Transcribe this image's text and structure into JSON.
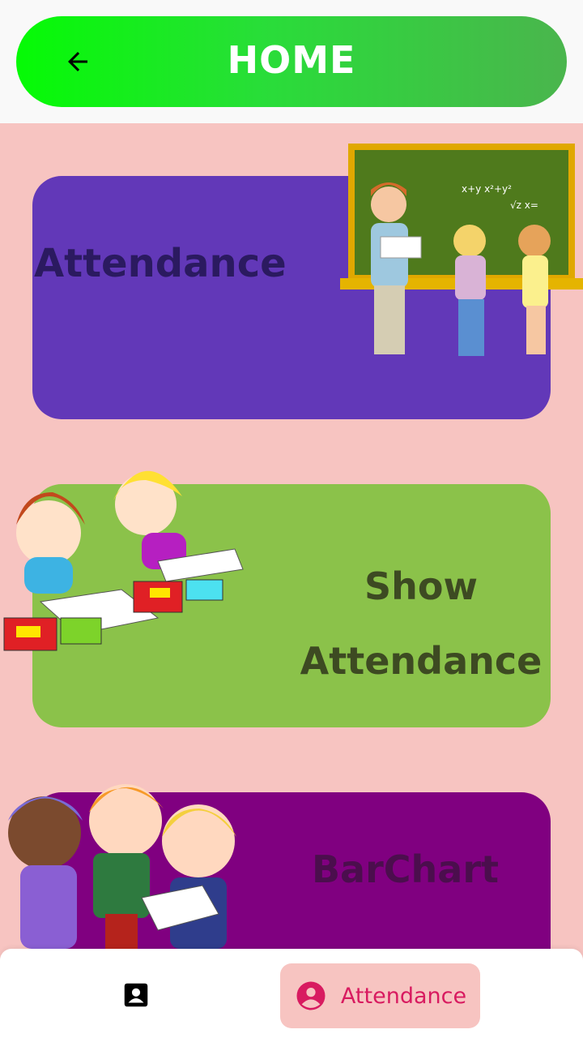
{
  "header": {
    "title": "HOME",
    "back_icon": "arrow-left-icon"
  },
  "cards": [
    {
      "label": "Attendance",
      "color": "#6238b8",
      "illustration": "teacher-chalkboard-illustration"
    },
    {
      "label_line1": "Show",
      "label_line2": "Attendance",
      "color": "#8bc24a",
      "illustration": "kids-studying-illustration"
    },
    {
      "label": "BarChart",
      "color": "#800080",
      "illustration": "kids-with-books-illustration"
    }
  ],
  "bottom_nav": {
    "items": [
      {
        "icon": "contact-card-icon"
      },
      {
        "icon": "account-circle-icon",
        "label": "Attendance",
        "active": true
      }
    ],
    "active_color": "#d81b60"
  }
}
